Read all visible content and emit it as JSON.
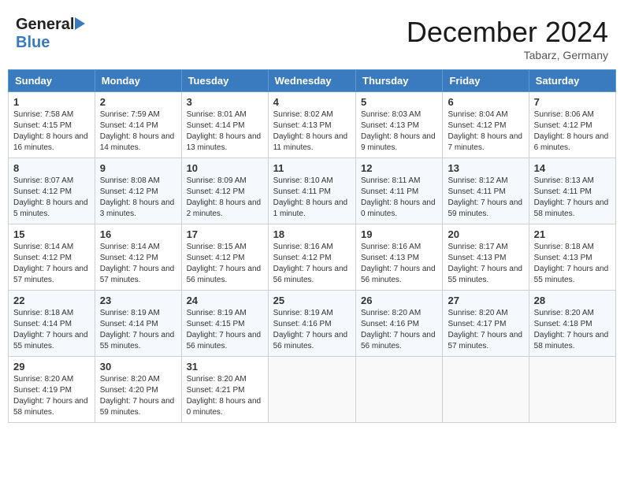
{
  "header": {
    "logo_general": "General",
    "logo_blue": "Blue",
    "title": "December 2024",
    "location": "Tabarz, Germany"
  },
  "weekdays": [
    "Sunday",
    "Monday",
    "Tuesday",
    "Wednesday",
    "Thursday",
    "Friday",
    "Saturday"
  ],
  "weeks": [
    [
      {
        "day": "1",
        "info": "Sunrise: 7:58 AM\nSunset: 4:15 PM\nDaylight: 8 hours and 16 minutes."
      },
      {
        "day": "2",
        "info": "Sunrise: 7:59 AM\nSunset: 4:14 PM\nDaylight: 8 hours and 14 minutes."
      },
      {
        "day": "3",
        "info": "Sunrise: 8:01 AM\nSunset: 4:14 PM\nDaylight: 8 hours and 13 minutes."
      },
      {
        "day": "4",
        "info": "Sunrise: 8:02 AM\nSunset: 4:13 PM\nDaylight: 8 hours and 11 minutes."
      },
      {
        "day": "5",
        "info": "Sunrise: 8:03 AM\nSunset: 4:13 PM\nDaylight: 8 hours and 9 minutes."
      },
      {
        "day": "6",
        "info": "Sunrise: 8:04 AM\nSunset: 4:12 PM\nDaylight: 8 hours and 7 minutes."
      },
      {
        "day": "7",
        "info": "Sunrise: 8:06 AM\nSunset: 4:12 PM\nDaylight: 8 hours and 6 minutes."
      }
    ],
    [
      {
        "day": "8",
        "info": "Sunrise: 8:07 AM\nSunset: 4:12 PM\nDaylight: 8 hours and 5 minutes."
      },
      {
        "day": "9",
        "info": "Sunrise: 8:08 AM\nSunset: 4:12 PM\nDaylight: 8 hours and 3 minutes."
      },
      {
        "day": "10",
        "info": "Sunrise: 8:09 AM\nSunset: 4:12 PM\nDaylight: 8 hours and 2 minutes."
      },
      {
        "day": "11",
        "info": "Sunrise: 8:10 AM\nSunset: 4:11 PM\nDaylight: 8 hours and 1 minute."
      },
      {
        "day": "12",
        "info": "Sunrise: 8:11 AM\nSunset: 4:11 PM\nDaylight: 8 hours and 0 minutes."
      },
      {
        "day": "13",
        "info": "Sunrise: 8:12 AM\nSunset: 4:11 PM\nDaylight: 7 hours and 59 minutes."
      },
      {
        "day": "14",
        "info": "Sunrise: 8:13 AM\nSunset: 4:11 PM\nDaylight: 7 hours and 58 minutes."
      }
    ],
    [
      {
        "day": "15",
        "info": "Sunrise: 8:14 AM\nSunset: 4:12 PM\nDaylight: 7 hours and 57 minutes."
      },
      {
        "day": "16",
        "info": "Sunrise: 8:14 AM\nSunset: 4:12 PM\nDaylight: 7 hours and 57 minutes."
      },
      {
        "day": "17",
        "info": "Sunrise: 8:15 AM\nSunset: 4:12 PM\nDaylight: 7 hours and 56 minutes."
      },
      {
        "day": "18",
        "info": "Sunrise: 8:16 AM\nSunset: 4:12 PM\nDaylight: 7 hours and 56 minutes."
      },
      {
        "day": "19",
        "info": "Sunrise: 8:16 AM\nSunset: 4:13 PM\nDaylight: 7 hours and 56 minutes."
      },
      {
        "day": "20",
        "info": "Sunrise: 8:17 AM\nSunset: 4:13 PM\nDaylight: 7 hours and 55 minutes."
      },
      {
        "day": "21",
        "info": "Sunrise: 8:18 AM\nSunset: 4:13 PM\nDaylight: 7 hours and 55 minutes."
      }
    ],
    [
      {
        "day": "22",
        "info": "Sunrise: 8:18 AM\nSunset: 4:14 PM\nDaylight: 7 hours and 55 minutes."
      },
      {
        "day": "23",
        "info": "Sunrise: 8:19 AM\nSunset: 4:14 PM\nDaylight: 7 hours and 55 minutes."
      },
      {
        "day": "24",
        "info": "Sunrise: 8:19 AM\nSunset: 4:15 PM\nDaylight: 7 hours and 56 minutes."
      },
      {
        "day": "25",
        "info": "Sunrise: 8:19 AM\nSunset: 4:16 PM\nDaylight: 7 hours and 56 minutes."
      },
      {
        "day": "26",
        "info": "Sunrise: 8:20 AM\nSunset: 4:16 PM\nDaylight: 7 hours and 56 minutes."
      },
      {
        "day": "27",
        "info": "Sunrise: 8:20 AM\nSunset: 4:17 PM\nDaylight: 7 hours and 57 minutes."
      },
      {
        "day": "28",
        "info": "Sunrise: 8:20 AM\nSunset: 4:18 PM\nDaylight: 7 hours and 58 minutes."
      }
    ],
    [
      {
        "day": "29",
        "info": "Sunrise: 8:20 AM\nSunset: 4:19 PM\nDaylight: 7 hours and 58 minutes."
      },
      {
        "day": "30",
        "info": "Sunrise: 8:20 AM\nSunset: 4:20 PM\nDaylight: 7 hours and 59 minutes."
      },
      {
        "day": "31",
        "info": "Sunrise: 8:20 AM\nSunset: 4:21 PM\nDaylight: 8 hours and 0 minutes."
      },
      {
        "day": "",
        "info": ""
      },
      {
        "day": "",
        "info": ""
      },
      {
        "day": "",
        "info": ""
      },
      {
        "day": "",
        "info": ""
      }
    ]
  ]
}
